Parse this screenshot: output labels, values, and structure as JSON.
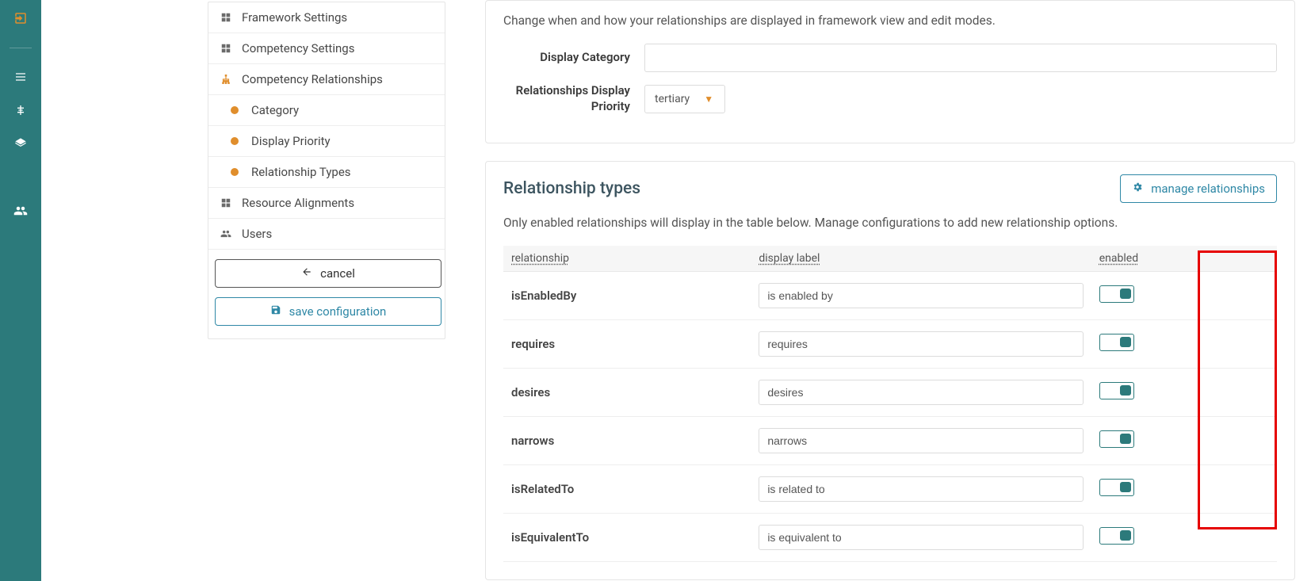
{
  "sidebar": {
    "items": [
      {
        "label": "Framework Settings"
      },
      {
        "label": "Competency Settings"
      },
      {
        "label": "Competency Relationships"
      },
      {
        "label": "Resource Alignments"
      },
      {
        "label": "Users"
      }
    ],
    "subitems": [
      {
        "label": "Category"
      },
      {
        "label": "Display Priority"
      },
      {
        "label": "Relationship Types"
      }
    ],
    "cancel": "cancel",
    "save": "save configuration"
  },
  "panel1": {
    "desc": "Change when and how your relationships are displayed in framework view and edit modes.",
    "display_category_label": "Display Category",
    "display_category_value": "",
    "priority_label": "Relationships Display Priority",
    "priority_value": "tertiary"
  },
  "panel2": {
    "title": "Relationship types",
    "manage": "manage relationships",
    "desc": "Only enabled relationships will display in the table below. Manage configurations to add new relationship options.",
    "headers": {
      "rel": "relationship",
      "label": "display label",
      "enabled": "enabled"
    },
    "rows": [
      {
        "name": "isEnabledBy",
        "label": "is enabled by"
      },
      {
        "name": "requires",
        "label": "requires"
      },
      {
        "name": "desires",
        "label": "desires"
      },
      {
        "name": "narrows",
        "label": "narrows"
      },
      {
        "name": "isRelatedTo",
        "label": "is related to"
      },
      {
        "name": "isEquivalentTo",
        "label": "is equivalent to"
      }
    ]
  }
}
